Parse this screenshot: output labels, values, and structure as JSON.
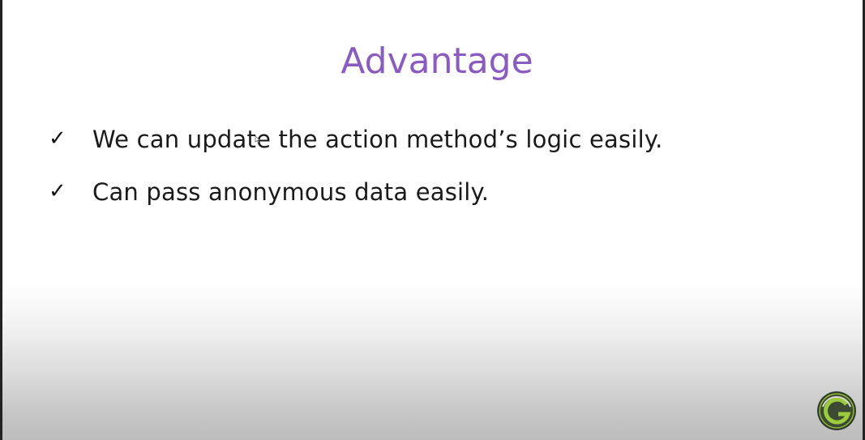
{
  "slide": {
    "title": "Advantage",
    "bullets": [
      {
        "marker": "✓",
        "text": "We can update the action method’s logic easily."
      },
      {
        "marker": "✓",
        "text": "Can pass anonymous data easily."
      }
    ]
  },
  "logo": {
    "icon": "g-logo-icon"
  },
  "colors": {
    "title": "#8a5cbf",
    "text": "#1a1a1a",
    "logo_ring": "#9ccc3d"
  }
}
